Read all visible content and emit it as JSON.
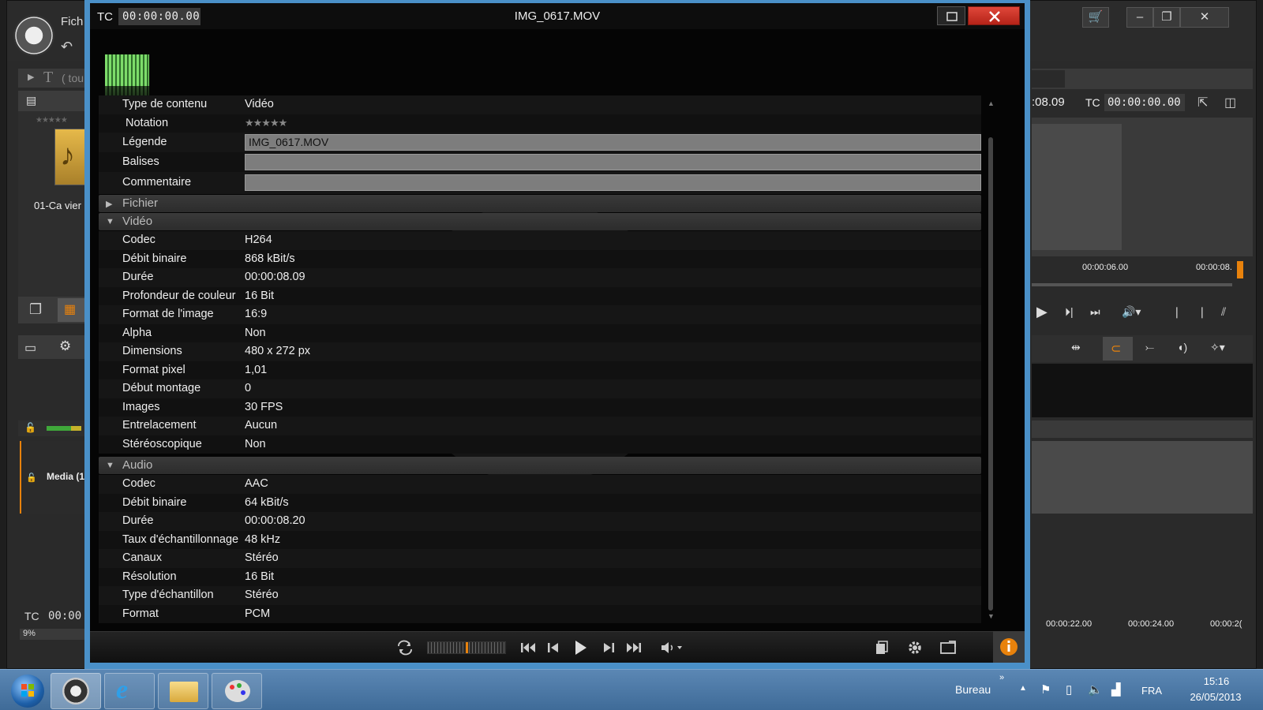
{
  "dialog": {
    "tc_label": "TC",
    "tc_value": "00:00:00.00",
    "file_title": "IMG_0617.MOV"
  },
  "properties": {
    "type_label": "Type de contenu",
    "type_value": "Vidéo",
    "notation_label": "Notation",
    "legend_label": "Légende",
    "legend_value": "IMG_0617.MOV",
    "tags_label": "Balises",
    "tags_value": "",
    "comment_label": "Commentaire",
    "comment_value": ""
  },
  "sections": {
    "file": "Fichier",
    "video": "Vidéo",
    "audio": "Audio"
  },
  "video": [
    {
      "label": "Codec",
      "value": "H264"
    },
    {
      "label": "Débit binaire",
      "value": "868 kBit/s"
    },
    {
      "label": "Durée",
      "value": "00:00:08.09"
    },
    {
      "label": "Profondeur de couleur",
      "value": "16 Bit"
    },
    {
      "label": "Format de l'image",
      "value": "16:9"
    },
    {
      "label": "Alpha",
      "value": "Non"
    },
    {
      "label": "Dimensions",
      "value": "480 x 272 px"
    },
    {
      "label": "Format pixel",
      "value": "1,01"
    },
    {
      "label": "Début montage",
      "value": "0"
    },
    {
      "label": "Images",
      "value": "30 FPS"
    },
    {
      "label": "Entrelacement",
      "value": "Aucun"
    },
    {
      "label": "Stéréoscopique",
      "value": "Non"
    }
  ],
  "audio": [
    {
      "label": "Codec",
      "value": "AAC"
    },
    {
      "label": "Débit binaire",
      "value": "64 kBit/s"
    },
    {
      "label": "Durée",
      "value": "00:00:08.20"
    },
    {
      "label": "Taux d'échantillonnage",
      "value": "48 kHz"
    },
    {
      "label": "Canaux",
      "value": "Stéréo"
    },
    {
      "label": "Résolution",
      "value": "16 Bit"
    },
    {
      "label": "Type d'échantillon",
      "value": "Stéréo"
    },
    {
      "label": "Format",
      "value": "PCM"
    }
  ],
  "background_app": {
    "menu_partial": "Fich",
    "filter_partial": "( tou",
    "media_item_partial": "01-Ca vier",
    "track_partial": "Media (1",
    "tc_label": "TC",
    "tc_value_partial": "00:00",
    "zoom": "9%",
    "right_time": ":08.09",
    "right_tc_label": "TC",
    "right_tc_value": "00:00:00.00",
    "ruler_1": "00:00:06.00",
    "ruler_2": "00:00:08.",
    "timeline_1": "00:00:22.00",
    "timeline_2": "00:00:24.00",
    "timeline_3": "00:00:2("
  },
  "taskbar": {
    "bureau": "Bureau",
    "language": "FRA",
    "time": "15:16",
    "date": "26/05/2013"
  },
  "colors": {
    "accent_orange": "#e8820c",
    "window_border": "#4a90c8",
    "close_red": "#c8321f"
  }
}
